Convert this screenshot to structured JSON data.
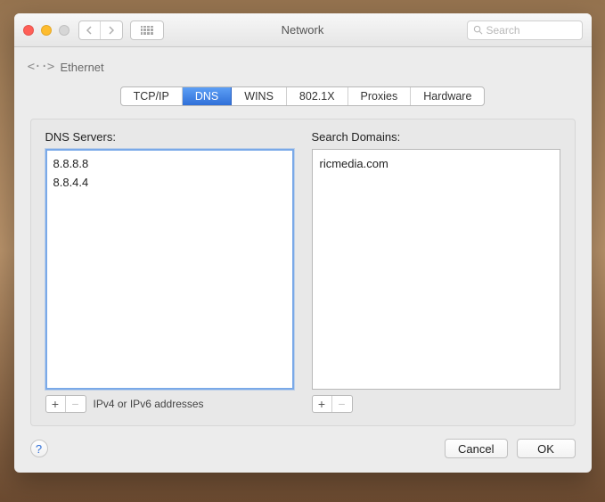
{
  "window": {
    "title": "Network"
  },
  "toolbar": {
    "search_placeholder": "Search"
  },
  "breadcrumb": {
    "connection_name": "Ethernet"
  },
  "tabs": {
    "items": [
      {
        "label": "TCP/IP",
        "active": false
      },
      {
        "label": "DNS",
        "active": true
      },
      {
        "label": "WINS",
        "active": false
      },
      {
        "label": "802.1X",
        "active": false
      },
      {
        "label": "Proxies",
        "active": false
      },
      {
        "label": "Hardware",
        "active": false
      }
    ]
  },
  "dns": {
    "servers_label": "DNS Servers:",
    "servers": [
      "8.8.8.8",
      "8.8.4.4"
    ],
    "hint": "IPv4 or IPv6 addresses",
    "domains_label": "Search Domains:",
    "domains": [
      "ricmedia.com"
    ]
  },
  "footer": {
    "cancel_label": "Cancel",
    "ok_label": "OK"
  }
}
